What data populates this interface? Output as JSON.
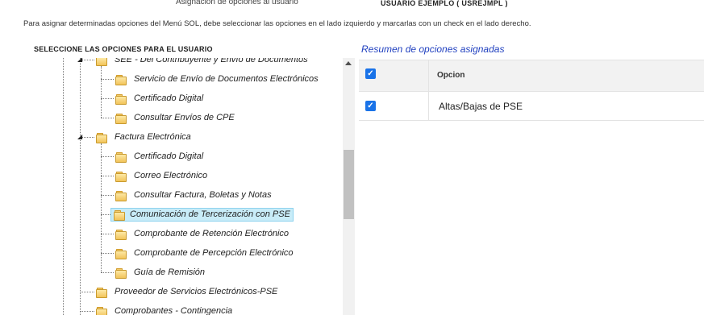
{
  "header": {
    "title": "Asignación de opciones al usuario",
    "user": "USUARIO EJEMPLO ( USREJMPL )",
    "instructions": "Para asignar determinadas opciones del Menú SOL, debe seleccionar las opciones en el lado izquierdo y marcarlas con un check en el lado derecho."
  },
  "left_panel": {
    "title": "SELECCIONE LAS OPCIONES PARA EL USUARIO",
    "tree": [
      {
        "label": "SEE - Del Contribuyente y Envío de Documentos",
        "level": 1,
        "expanded": true
      },
      {
        "label": "Servicio de Envío de Documentos Electrónicos",
        "level": 2
      },
      {
        "label": "Certificado Digital",
        "level": 2
      },
      {
        "label": "Consultar Envíos de CPE",
        "level": 2
      },
      {
        "label": "Factura Electrónica",
        "level": 1,
        "expanded": true
      },
      {
        "label": "Certificado Digital",
        "level": 2
      },
      {
        "label": "Correo Electrónico",
        "level": 2
      },
      {
        "label": "Consultar Factura, Boletas y Notas",
        "level": 2
      },
      {
        "label": "Comunicación de Tercerización con PSE",
        "level": 2,
        "selected": true
      },
      {
        "label": "Comprobante de Retención Electrónico",
        "level": 2
      },
      {
        "label": "Comprobante de Percepción Electrónico",
        "level": 2
      },
      {
        "label": "Guía de Remisión",
        "level": 2
      },
      {
        "label": "Proveedor de Servicios Electrónicos-PSE",
        "level": 1,
        "expanded": false
      },
      {
        "label": "Comprobantes - Contingencia",
        "level": 1,
        "expanded": false
      }
    ]
  },
  "right_panel": {
    "title": "Resumen de opciones asignadas",
    "column_header": "Opcion",
    "select_all_checked": true,
    "rows": [
      {
        "checked": true,
        "option": "Altas/Bajas de PSE"
      }
    ]
  },
  "icons": {
    "folder": "folder-icon",
    "check": "✓",
    "expand": "◢",
    "collapse": "▸"
  },
  "colors": {
    "accent": "#1a73e8",
    "selection": "#c8ecf8",
    "link_title": "#1f3fbf"
  }
}
